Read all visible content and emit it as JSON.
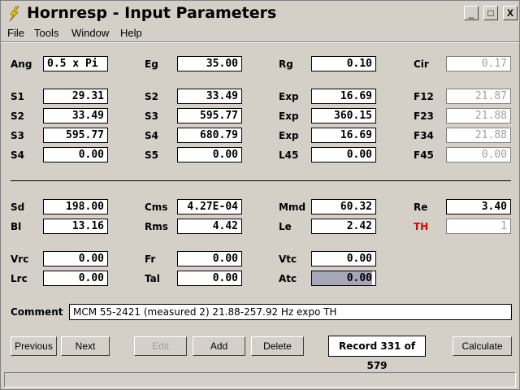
{
  "window": {
    "title": "Hornresp - Input Parameters",
    "controls": {
      "minimize": "_",
      "maximize": "□",
      "close": "X"
    }
  },
  "menu": [
    "File",
    "Tools",
    "Window",
    "Help"
  ],
  "params": {
    "Ang": "0.5 x Pi",
    "Eg": "35.00",
    "Rg": "0.10",
    "Cir": "0.17",
    "S1": "29.31",
    "S2a": "33.49",
    "Exp1": "16.69",
    "F12": "21.87",
    "S2b": "33.49",
    "S3a": "595.77",
    "Exp2": "360.15",
    "F23": "21.88",
    "S3b": "595.77",
    "S4a": "680.79",
    "Exp3": "16.69",
    "F34": "21.88",
    "S4b": "0.00",
    "S5": "0.00",
    "L45": "0.00",
    "F45": "0.00",
    "Sd": "198.00",
    "Cms": "4.27E-04",
    "Mmd": "60.32",
    "Re": "3.40",
    "Bl": "13.16",
    "Rms": "4.42",
    "Le": "2.42",
    "TH": "1",
    "Vrc": "0.00",
    "Fr": "0.00",
    "Vtc": "0.00",
    "Lrc": "0.00",
    "Tal": "0.00",
    "Atc": "0.00"
  },
  "labels": {
    "Ang": "Ang",
    "Eg": "Eg",
    "Rg": "Rg",
    "Cir": "Cir",
    "S1": "S1",
    "S2": "S2",
    "Exp": "Exp",
    "F12": "F12",
    "S3": "S3",
    "F23": "F23",
    "S4": "S4",
    "F34": "F34",
    "S5": "S5",
    "L45": "L45",
    "F45": "F45",
    "Sd": "Sd",
    "Cms": "Cms",
    "Mmd": "Mmd",
    "Re": "Re",
    "Bl": "Bl",
    "Rms": "Rms",
    "Le": "Le",
    "TH": "TH",
    "Vrc": "Vrc",
    "Fr": "Fr",
    "Vtc": "Vtc",
    "Lrc": "Lrc",
    "Tal": "Tal",
    "Atc": "Atc",
    "Comment": "Comment"
  },
  "comment": "MCM 55-2421 (measured 2) 21.88-257.92 Hz expo TH",
  "buttons": {
    "previous": "Previous",
    "next": "Next",
    "edit": "Edit",
    "add": "Add",
    "delete": "Delete",
    "calculate": "Calculate"
  },
  "record": "Record 331 of 579",
  "colors": {
    "th_label": "#e00000",
    "readonly_text": "#a0a0a0",
    "window_bg": "#d4d0c8"
  }
}
